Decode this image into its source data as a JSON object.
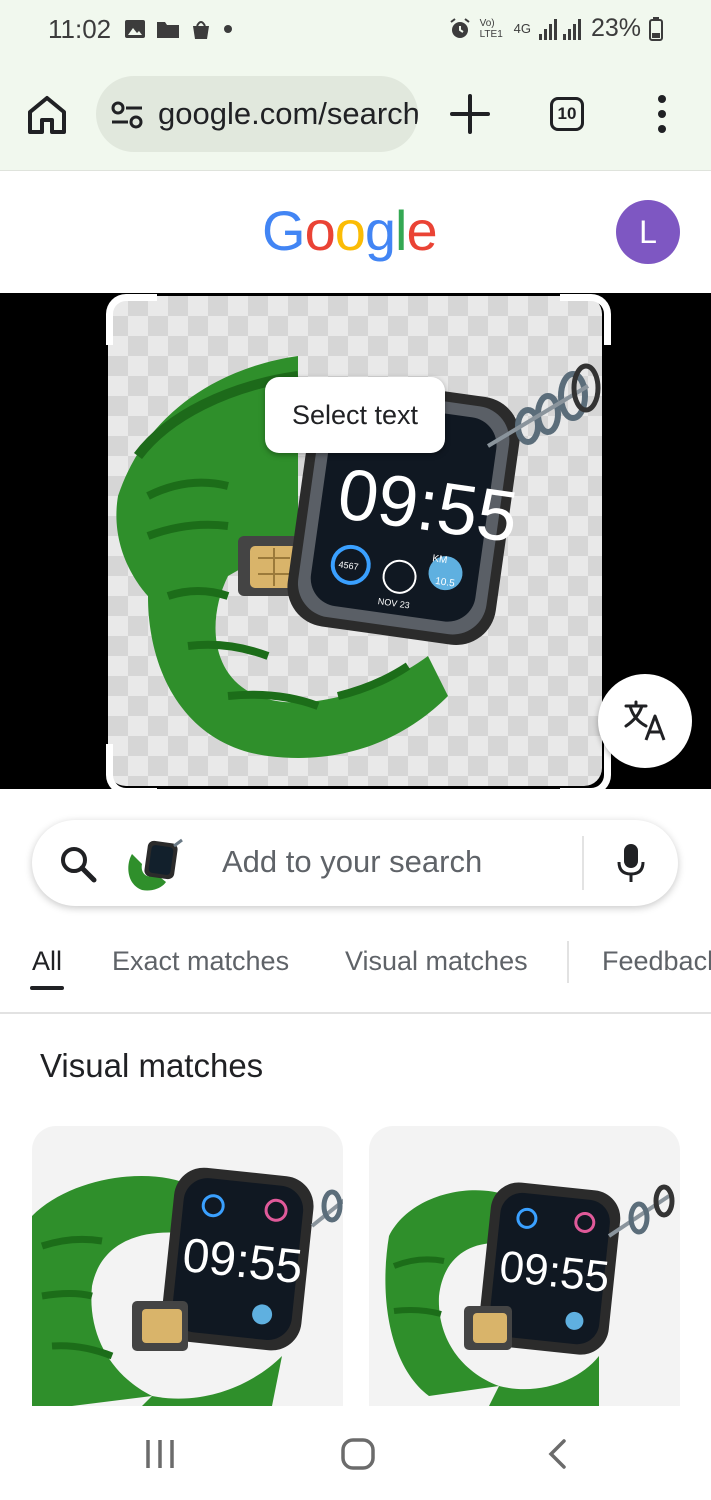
{
  "status_bar": {
    "time": "11:02",
    "battery": "23%",
    "network_label": "4G",
    "volte_label": "Vo) LTE1"
  },
  "browser": {
    "url": "google.com/search",
    "tab_count": "10"
  },
  "google": {
    "logo_letters": [
      "G",
      "o",
      "o",
      "g",
      "l",
      "e"
    ],
    "logo_colors": [
      "#4285F4",
      "#EA4335",
      "#FBBC05",
      "#4285F4",
      "#34A853",
      "#EA4335"
    ],
    "avatar_letter": "L"
  },
  "lens": {
    "select_text_label": "Select text",
    "search_placeholder": "Add to your search"
  },
  "tabs": [
    {
      "label": "All",
      "active": true
    },
    {
      "label": "Exact matches",
      "active": false
    },
    {
      "label": "Visual matches",
      "active": false
    },
    {
      "label": "Feedback",
      "active": false
    }
  ],
  "visual_matches": {
    "heading": "Visual matches",
    "cards": [
      {
        "description": "green strap smartwatch with SIM tray"
      },
      {
        "description": "green strap smartwatch with SIM tray"
      }
    ]
  },
  "watch_face": {
    "time_text": "09:55",
    "km_label": "KM",
    "km_value": "10.5",
    "steps_value": "4567",
    "date_text": "NOV 23"
  },
  "colors": {
    "chrome_bg": "#f1f8ee",
    "strap_green": "#2e8b2e",
    "avatar_purple": "#7e57c2"
  }
}
